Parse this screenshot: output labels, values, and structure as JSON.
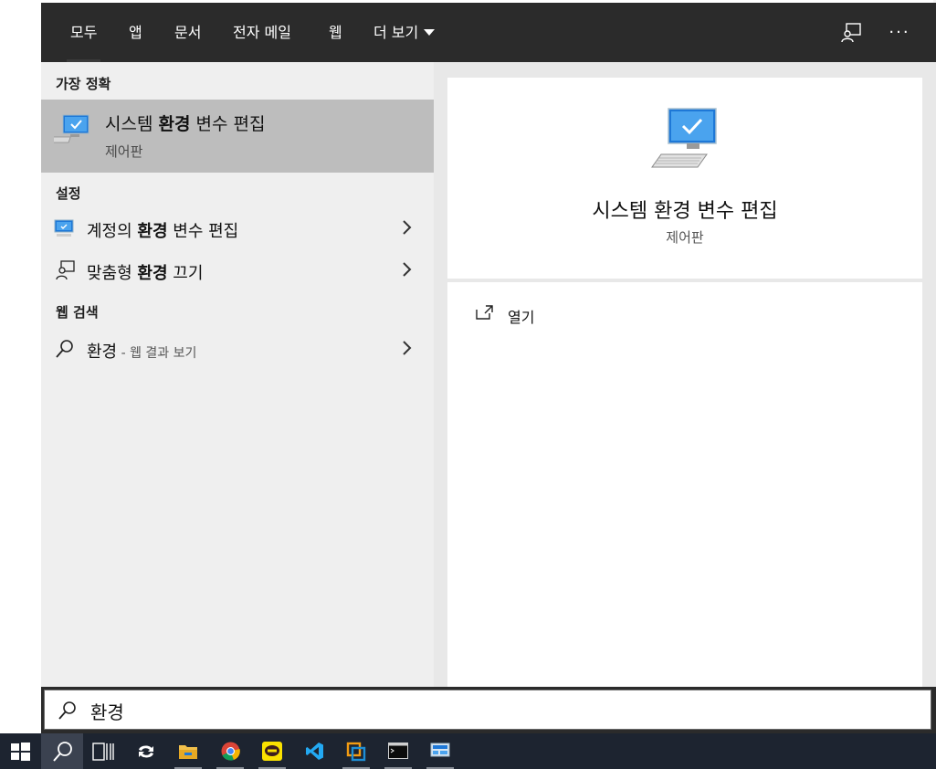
{
  "tabs": [
    "모두",
    "앱",
    "문서",
    "전자 메일",
    "웹",
    "더 보기"
  ],
  "sections": {
    "best_match": "가장 정확",
    "settings": "설정",
    "web_search": "웹 검색"
  },
  "best_match": {
    "title_pre": "시스템 ",
    "title_bold": "환경",
    "title_post": " 변수 편집",
    "subtitle": "제어판"
  },
  "settings_items": [
    {
      "pre": "계정의 ",
      "bold": "환경",
      "post": " 변수 편집"
    },
    {
      "pre": "맞춤형 ",
      "bold": "환경",
      "post": " 끄기"
    }
  ],
  "web_item": {
    "query": "환경",
    "hint": " - 웹 결과 보기"
  },
  "preview": {
    "title": "시스템 환경 변수 편집",
    "subtitle": "제어판"
  },
  "actions": {
    "open": "열기"
  },
  "search": {
    "value": "환경"
  },
  "taskbar": [
    "start-icon",
    "search-icon",
    "task-view-icon",
    "sync-icon",
    "file-explorer-icon",
    "chrome-icon",
    "kakaotalk-icon",
    "vscode-icon",
    "virtualbox-icon",
    "terminal-icon",
    "control-panel-icon"
  ],
  "colors": {
    "accent": "#1e78d7",
    "topbar": "#2b2b2b",
    "selected": "#bdbdbd",
    "taskbar": "#1d2430"
  }
}
